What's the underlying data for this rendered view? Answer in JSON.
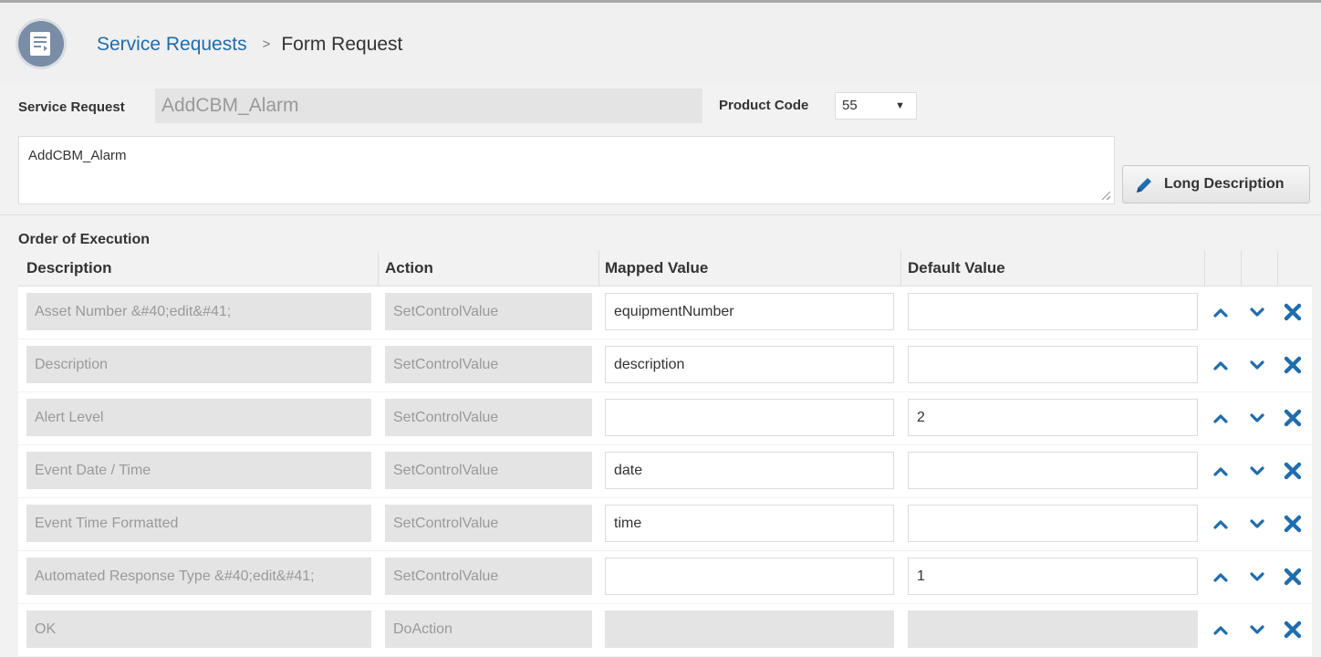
{
  "header": {
    "breadcrumb_link": "Service Requests",
    "breadcrumb_sep": ">",
    "breadcrumb_current": "Form Request",
    "icon": "form-document-icon"
  },
  "form": {
    "service_request_label": "Service Request",
    "service_request_value": "AddCBM_Alarm",
    "product_code_label": "Product Code",
    "product_code_value": "55",
    "description_value": "AddCBM_Alarm",
    "long_description_button": "Long Description"
  },
  "execution": {
    "title": "Order of Execution",
    "columns": [
      "Description",
      "Action",
      "Mapped Value",
      "Default Value"
    ],
    "rows": [
      {
        "description": "Asset Number &#40;edit&#41;",
        "action": "SetControlValue",
        "mapped": "equipmentNumber",
        "default": ""
      },
      {
        "description": "Description",
        "action": "SetControlValue",
        "mapped": "description",
        "default": ""
      },
      {
        "description": "Alert Level",
        "action": "SetControlValue",
        "mapped": "",
        "default": "2"
      },
      {
        "description": "Event Date / Time",
        "action": "SetControlValue",
        "mapped": "date",
        "default": ""
      },
      {
        "description": "Event Time Formatted",
        "action": "SetControlValue",
        "mapped": "time",
        "default": ""
      },
      {
        "description": "Automated Response Type &#40;edit&#41;",
        "action": "SetControlValue",
        "mapped": "",
        "default": "1"
      },
      {
        "description": "OK",
        "action": "DoAction",
        "mapped": "",
        "default": ""
      }
    ]
  },
  "colors": {
    "link": "#1f6dad",
    "icon_blue": "#1f6dad",
    "readonly_bg": "#e4e4e4"
  }
}
